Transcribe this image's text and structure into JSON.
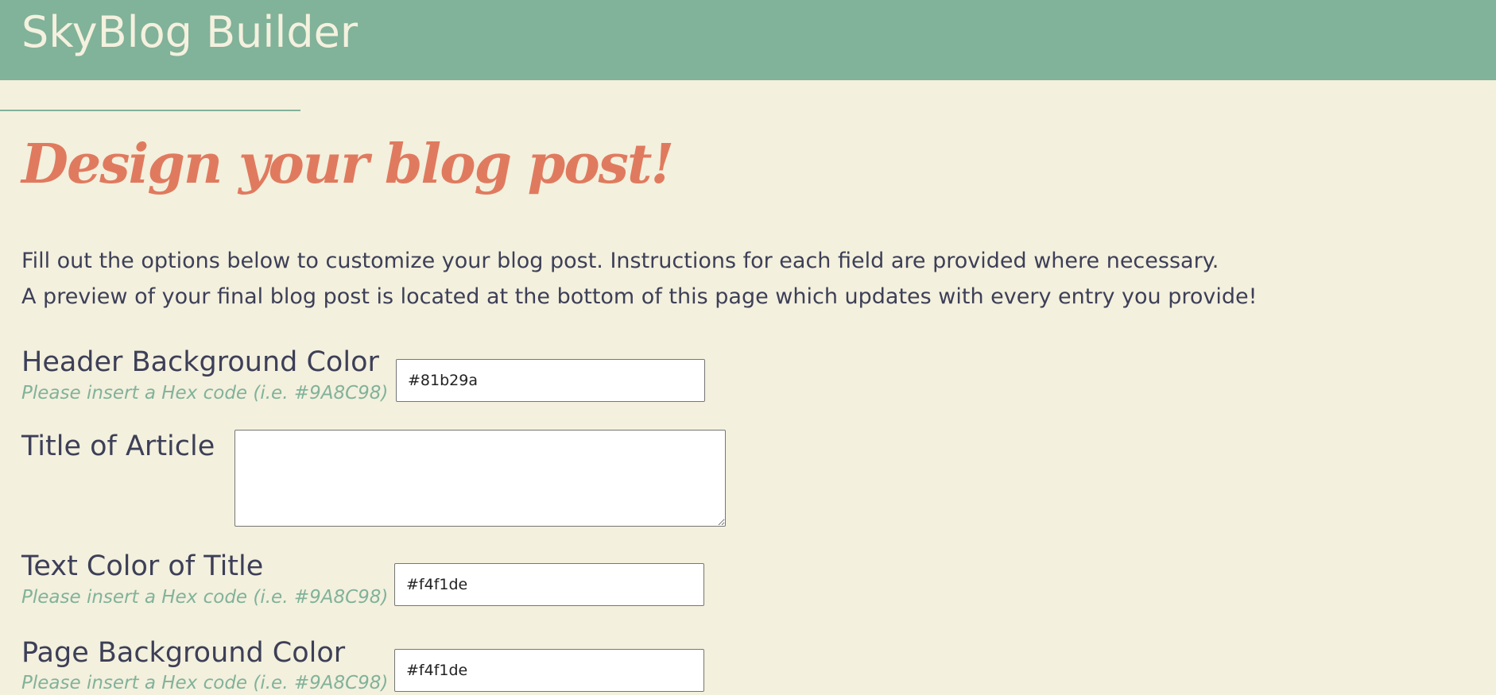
{
  "header": {
    "site_title": "SkyBlog Builder"
  },
  "colors": {
    "header_bg": "#81b29a",
    "page_bg": "#f3f0dd",
    "headline": "#e07a5f",
    "text": "#3d3f58",
    "hint": "#81b29a"
  },
  "intro": {
    "headline": "Design your blog post!",
    "line1": "Fill out the options below to customize your blog post. Instructions for each field are provided where necessary.",
    "line2": "A preview of your final blog post is located at the bottom of this page which updates with every entry you provide!"
  },
  "form": {
    "header_bg_color": {
      "label": "Header Background Color",
      "hint": "Please insert a Hex code (i.e. #9A8C98)",
      "value": "#81b29a"
    },
    "title_of_article": {
      "label": "Title of Article",
      "value": ""
    },
    "title_text_color": {
      "label": "Text Color of Title",
      "hint": "Please insert a Hex code (i.e. #9A8C98)",
      "value": "#f4f1de"
    },
    "page_bg_color": {
      "label": "Page Background Color",
      "hint": "Please insert a Hex code (i.e. #9A8C98)",
      "value": "#f4f1de"
    }
  }
}
